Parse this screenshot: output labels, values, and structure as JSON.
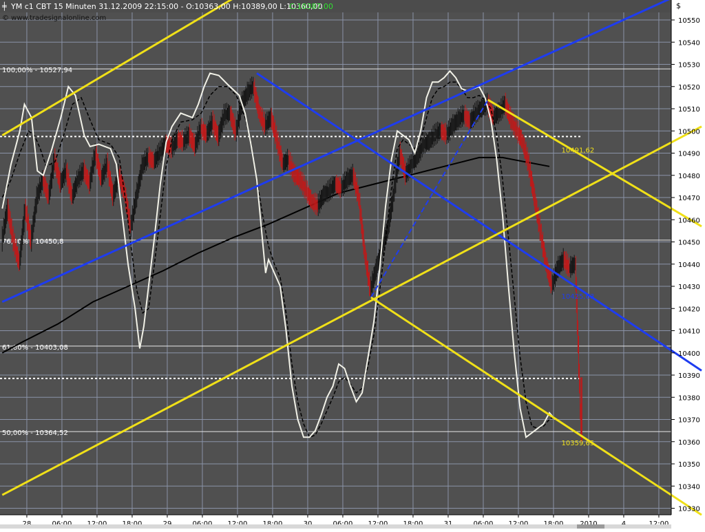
{
  "header": {
    "cursor_glyph": "╪",
    "symbol_text": "YM c1 CBT 15 Minuten  31.12.2009 22:15:00 - O:10363,00 H:10389,00 L:10360,00",
    "close_text": "C:10387,00",
    "watermark": "© www.tradesignalonline.com"
  },
  "colors": {
    "background": "#4c4c4c",
    "plot_bg": "#505050",
    "panel": "#ffffff",
    "grid": "#8a93a8",
    "price_up": "#141414",
    "price_down": "#c01818",
    "ma_black": "#000000",
    "osc_white": "#f2f2e8",
    "osc_signal": "#000000",
    "fib_line": "#e8e8e8",
    "blue": "#1e3cf0",
    "yellow": "#f0e018",
    "close_highlight": "#30e030"
  },
  "chart_data": {
    "type": "candlestick",
    "instrument": "YM c1 CBT",
    "interval": "15 Minuten",
    "timestamp": "31.12.2009 22:15:00",
    "ohlc": {
      "open": 10363.0,
      "high": 10389.0,
      "low": 10360.0,
      "close": 10387.0
    },
    "y_axis_unit": "$",
    "ylim": [
      10326,
      10566
    ],
    "yticks": [
      10330,
      10340,
      10350,
      10360,
      10370,
      10380,
      10390,
      10400,
      10410,
      10420,
      10430,
      10440,
      10450,
      10460,
      10470,
      10480,
      10490,
      10500,
      10510,
      10520,
      10530,
      10540,
      10550
    ],
    "x_ticks": [
      {
        "label": "28",
        "t": 0.7
      },
      {
        "label": "06:00",
        "t": 6.7
      },
      {
        "label": "12:00",
        "t": 12.7
      },
      {
        "label": "18:00",
        "t": 18.7
      },
      {
        "label": "29",
        "t": 24.7
      },
      {
        "label": "06:00",
        "t": 30.7
      },
      {
        "label": "12:00",
        "t": 36.7
      },
      {
        "label": "18:00",
        "t": 42.7
      },
      {
        "label": "30",
        "t": 48.7
      },
      {
        "label": "06:00",
        "t": 54.7
      },
      {
        "label": "12:00",
        "t": 60.7
      },
      {
        "label": "18:00",
        "t": 66.7
      },
      {
        "label": "31",
        "t": 72.7
      },
      {
        "label": "06:00",
        "t": 78.7
      },
      {
        "label": "12:00",
        "t": 84.7
      },
      {
        "label": "18:00",
        "t": 90.7
      },
      {
        "label": "2010",
        "t": 96.7
      },
      {
        "label": "4",
        "t": 102.7
      },
      {
        "label": "12:00",
        "t": 108.7
      }
    ],
    "x_range": [
      -3.5,
      116
    ],
    "price_path": [
      [
        -3.5,
        10450
      ],
      [
        -2.5,
        10465
      ],
      [
        -1.5,
        10450
      ],
      [
        -0.5,
        10440
      ],
      [
        0.5,
        10465
      ],
      [
        1.5,
        10450
      ],
      [
        2.5,
        10470
      ],
      [
        3.5,
        10478
      ],
      [
        4.5,
        10470
      ],
      [
        5.5,
        10487
      ],
      [
        6.5,
        10476
      ],
      [
        7.5,
        10482
      ],
      [
        8.5,
        10470
      ],
      [
        9.5,
        10478
      ],
      [
        10.5,
        10482
      ],
      [
        11.5,
        10476
      ],
      [
        12.5,
        10490
      ],
      [
        13.5,
        10478
      ],
      [
        14.5,
        10485
      ],
      [
        15.5,
        10470
      ],
      [
        16.5,
        10480
      ],
      [
        17.5,
        10472
      ],
      [
        18.5,
        10456
      ],
      [
        19.5,
        10470
      ],
      [
        20.5,
        10484
      ],
      [
        21.5,
        10488
      ],
      [
        22.5,
        10486
      ],
      [
        23.5,
        10490
      ],
      [
        24.5,
        10494
      ],
      [
        25.5,
        10492
      ],
      [
        26.5,
        10496
      ],
      [
        27.5,
        10495
      ],
      [
        28.5,
        10498
      ],
      [
        29.5,
        10493
      ],
      [
        30.5,
        10501
      ],
      [
        31.5,
        10498
      ],
      [
        32.5,
        10504
      ],
      [
        33.5,
        10497
      ],
      [
        34.5,
        10507
      ],
      [
        35.5,
        10508
      ],
      [
        36.5,
        10499
      ],
      [
        37.5,
        10512
      ],
      [
        38.5,
        10517
      ],
      [
        39.5,
        10520
      ],
      [
        40.5,
        10508
      ],
      [
        41.5,
        10502
      ],
      [
        42.5,
        10506
      ],
      [
        43.5,
        10496
      ],
      [
        44.5,
        10485
      ],
      [
        45.5,
        10487
      ],
      [
        46.5,
        10480
      ],
      [
        47.5,
        10478
      ],
      [
        48.5,
        10473
      ],
      [
        49.5,
        10468
      ],
      [
        50.5,
        10466
      ],
      [
        51.5,
        10471
      ],
      [
        52.5,
        10473
      ],
      [
        53.5,
        10476
      ],
      [
        54.5,
        10474
      ],
      [
        55.5,
        10478
      ],
      [
        56.5,
        10480
      ],
      [
        57.5,
        10470
      ],
      [
        58.5,
        10445
      ],
      [
        59.5,
        10428
      ],
      [
        60.5,
        10438
      ],
      [
        61.5,
        10447
      ],
      [
        62.5,
        10456
      ],
      [
        63.5,
        10472
      ],
      [
        64.5,
        10490
      ],
      [
        65.5,
        10480
      ],
      [
        66.5,
        10485
      ],
      [
        67.5,
        10488
      ],
      [
        68.5,
        10494
      ],
      [
        69.5,
        10495
      ],
      [
        70.5,
        10498
      ],
      [
        71.5,
        10500
      ],
      [
        72.5,
        10498
      ],
      [
        73.5,
        10502
      ],
      [
        74.5,
        10505
      ],
      [
        75.5,
        10507
      ],
      [
        76.5,
        10504
      ],
      [
        77.5,
        10508
      ],
      [
        78.5,
        10510
      ],
      [
        79.5,
        10512
      ],
      [
        80.5,
        10506
      ],
      [
        81.5,
        10508
      ],
      [
        82.5,
        10512
      ],
      [
        83.5,
        10505
      ],
      [
        84.5,
        10500
      ],
      [
        85.5,
        10495
      ],
      [
        86.5,
        10485
      ],
      [
        87.5,
        10470
      ],
      [
        88.5,
        10455
      ],
      [
        89.5,
        10440
      ],
      [
        90.5,
        10430
      ],
      [
        91.5,
        10438
      ],
      [
        92.5,
        10442
      ],
      [
        93.5,
        10438
      ],
      [
        94.5,
        10440
      ],
      [
        95.5,
        10365
      ]
    ],
    "ma_path": [
      [
        -3.5,
        10400
      ],
      [
        0,
        10405
      ],
      [
        6,
        10413
      ],
      [
        12,
        10423
      ],
      [
        18,
        10430
      ],
      [
        24,
        10437
      ],
      [
        30,
        10445
      ],
      [
        36,
        10452
      ],
      [
        42,
        10458
      ],
      [
        48,
        10465
      ],
      [
        54,
        10472
      ],
      [
        60,
        10476
      ],
      [
        66,
        10480
      ],
      [
        72,
        10484
      ],
      [
        78,
        10488
      ],
      [
        82,
        10488
      ],
      [
        84,
        10487
      ],
      [
        86,
        10486
      ],
      [
        90,
        10484
      ]
    ],
    "osc_white_path": [
      [
        -3.5,
        10465
      ],
      [
        -2,
        10485
      ],
      [
        -0.5,
        10500
      ],
      [
        0.3,
        10512
      ],
      [
        1.5,
        10506
      ],
      [
        2.5,
        10482
      ],
      [
        3.5,
        10480
      ],
      [
        5,
        10492
      ],
      [
        6.5,
        10506
      ],
      [
        7.8,
        10520
      ],
      [
        9,
        10516
      ],
      [
        10.5,
        10498
      ],
      [
        11.5,
        10493
      ],
      [
        13,
        10494
      ],
      [
        15,
        10492
      ],
      [
        16,
        10485
      ],
      [
        17,
        10462
      ],
      [
        18,
        10440
      ],
      [
        19.2,
        10420
      ],
      [
        20,
        10402
      ],
      [
        20.7,
        10412
      ],
      [
        21.5,
        10430
      ],
      [
        22.5,
        10452
      ],
      [
        23.5,
        10476
      ],
      [
        24.5,
        10495
      ],
      [
        25.5,
        10502
      ],
      [
        27,
        10508
      ],
      [
        29,
        10506
      ],
      [
        30,
        10512
      ],
      [
        31,
        10520
      ],
      [
        32,
        10526
      ],
      [
        33.5,
        10525
      ],
      [
        35,
        10521
      ],
      [
        37,
        10516
      ],
      [
        38,
        10508
      ],
      [
        39,
        10494
      ],
      [
        40,
        10478
      ],
      [
        41,
        10450
      ],
      [
        41.5,
        10436
      ],
      [
        42,
        10442
      ],
      [
        43,
        10436
      ],
      [
        44,
        10430
      ],
      [
        45,
        10410
      ],
      [
        46,
        10385
      ],
      [
        47,
        10370
      ],
      [
        48,
        10362
      ],
      [
        49,
        10362
      ],
      [
        50,
        10365
      ],
      [
        51,
        10372
      ],
      [
        52,
        10380
      ],
      [
        53,
        10385
      ],
      [
        54,
        10395
      ],
      [
        55,
        10393
      ],
      [
        56,
        10385
      ],
      [
        57,
        10378
      ],
      [
        58,
        10382
      ],
      [
        59,
        10398
      ],
      [
        60,
        10414
      ],
      [
        61,
        10438
      ],
      [
        62,
        10466
      ],
      [
        63,
        10487
      ],
      [
        64,
        10500
      ],
      [
        65,
        10498
      ],
      [
        66,
        10496
      ],
      [
        67,
        10490
      ],
      [
        68,
        10500
      ],
      [
        69,
        10515
      ],
      [
        70,
        10522
      ],
      [
        71,
        10522
      ],
      [
        72,
        10524
      ],
      [
        73,
        10527
      ],
      [
        74,
        10524
      ],
      [
        75,
        10519
      ],
      [
        76,
        10518
      ],
      [
        77,
        10519
      ],
      [
        78,
        10520
      ],
      [
        79,
        10515
      ],
      [
        80,
        10505
      ],
      [
        81,
        10487
      ],
      [
        82,
        10462
      ],
      [
        83,
        10430
      ],
      [
        84,
        10400
      ],
      [
        85,
        10375
      ],
      [
        86,
        10362
      ],
      [
        87,
        10364
      ],
      [
        88,
        10366
      ],
      [
        89,
        10368
      ],
      [
        90,
        10373
      ],
      [
        91,
        10370
      ]
    ],
    "osc_black_path": [
      [
        -3.5,
        10470
      ],
      [
        -2,
        10478
      ],
      [
        -0.5,
        10490
      ],
      [
        1,
        10500
      ],
      [
        2,
        10498
      ],
      [
        3,
        10492
      ],
      [
        4,
        10484
      ],
      [
        5.5,
        10486
      ],
      [
        7,
        10498
      ],
      [
        8.5,
        10512
      ],
      [
        10,
        10515
      ],
      [
        11.5,
        10505
      ],
      [
        13,
        10496
      ],
      [
        15,
        10494
      ],
      [
        16.5,
        10488
      ],
      [
        17.5,
        10470
      ],
      [
        18.5,
        10448
      ],
      [
        19.5,
        10428
      ],
      [
        20.5,
        10418
      ],
      [
        21.5,
        10420
      ],
      [
        22.5,
        10440
      ],
      [
        23.5,
        10462
      ],
      [
        24.5,
        10484
      ],
      [
        25.5,
        10496
      ],
      [
        27,
        10504
      ],
      [
        29,
        10505
      ],
      [
        30.5,
        10508
      ],
      [
        32,
        10516
      ],
      [
        33.5,
        10520
      ],
      [
        35,
        10520
      ],
      [
        36.5,
        10516
      ],
      [
        38,
        10506
      ],
      [
        39,
        10495
      ],
      [
        40,
        10478
      ],
      [
        41,
        10462
      ],
      [
        42,
        10448
      ],
      [
        43,
        10440
      ],
      [
        44,
        10434
      ],
      [
        45,
        10418
      ],
      [
        46,
        10395
      ],
      [
        47,
        10378
      ],
      [
        48,
        10368
      ],
      [
        49,
        10362
      ],
      [
        50,
        10363
      ],
      [
        51,
        10368
      ],
      [
        52,
        10374
      ],
      [
        53,
        10380
      ],
      [
        54,
        10387
      ],
      [
        55,
        10389
      ],
      [
        56,
        10386
      ],
      [
        57,
        10382
      ],
      [
        58,
        10384
      ],
      [
        59,
        10394
      ],
      [
        60,
        10408
      ],
      [
        61,
        10428
      ],
      [
        62,
        10450
      ],
      [
        63,
        10474
      ],
      [
        64,
        10492
      ],
      [
        65,
        10496
      ],
      [
        66,
        10494
      ],
      [
        67,
        10492
      ],
      [
        68,
        10496
      ],
      [
        69,
        10506
      ],
      [
        70,
        10515
      ],
      [
        71,
        10519
      ],
      [
        72,
        10520
      ],
      [
        73,
        10522
      ],
      [
        74,
        10522
      ],
      [
        75,
        10519
      ],
      [
        76,
        10515
      ],
      [
        77,
        10515
      ],
      [
        78,
        10516
      ],
      [
        79,
        10514
      ],
      [
        80,
        10510
      ],
      [
        81,
        10498
      ],
      [
        82,
        10478
      ],
      [
        83,
        10452
      ],
      [
        84,
        10425
      ],
      [
        85,
        10398
      ],
      [
        86,
        10378
      ],
      [
        87,
        10367
      ],
      [
        88,
        10366
      ],
      [
        89,
        10367
      ],
      [
        90,
        10370
      ],
      [
        91,
        10372
      ]
    ],
    "fib_levels": [
      {
        "label": "100,00% - 10527,94",
        "value": 10527.94
      },
      {
        "label": "76,40% - 10450,8",
        "value": 10450.8
      },
      {
        "label": "61,80% - 10403,08",
        "value": 10403.08
      },
      {
        "label": "50,00% - 10364,52",
        "value": 10364.52
      }
    ],
    "dotted_levels": [
      10497.5,
      10388.5
    ],
    "trendlines": [
      {
        "color": "blue",
        "style": "solid",
        "from": [
          -3.5,
          10423
        ],
        "to": [
          116,
          10566
        ]
      },
      {
        "color": "blue",
        "style": "solid",
        "from": [
          40,
          10526
        ],
        "to": [
          116,
          10392
        ]
      },
      {
        "color": "blue",
        "style": "dashed",
        "from": [
          59.5,
          10425
        ],
        "to": [
          79.5,
          10514
        ]
      },
      {
        "color": "yellow",
        "style": "solid",
        "from": [
          -3.5,
          10498
        ],
        "to": [
          40,
          10566
        ]
      },
      {
        "color": "yellow",
        "style": "solid",
        "from": [
          -3.5,
          10336
        ],
        "to": [
          116,
          10502
        ]
      },
      {
        "color": "yellow",
        "style": "solid",
        "from": [
          79.5,
          10514
        ],
        "to": [
          116,
          10457
        ]
      },
      {
        "color": "yellow",
        "style": "solid",
        "from": [
          59.5,
          10425
        ],
        "to": [
          116,
          10327
        ]
      }
    ],
    "annotations": [
      {
        "label": "10491,62",
        "x": 89,
        "y": 10491.62,
        "color": "yellow"
      },
      {
        "label": "10425,63",
        "x": 89,
        "y": 10425.63,
        "color": "blue"
      },
      {
        "label": "10359,65",
        "x": 89,
        "y": 10359.65,
        "color": "yellow"
      }
    ]
  }
}
